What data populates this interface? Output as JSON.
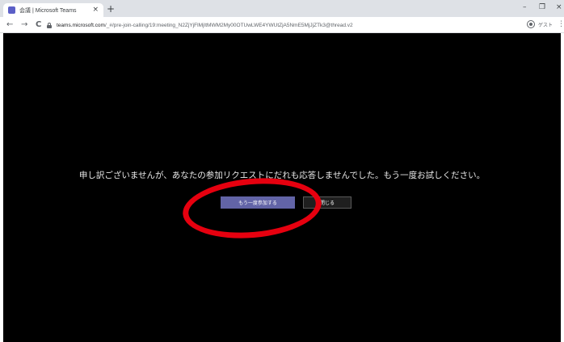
{
  "browser": {
    "tab_title": "会議 | Microsoft Teams",
    "tab_close": "×",
    "new_tab": "+",
    "url_host": "teams.microsoft.com",
    "url_path": "/_#/pre-join-calling/19:meeting_N2ZjYjFlMjItMWM2My00OTUwLWE4YWUtZjA5NmE5MjJjZTk3@thread.v2",
    "profile_label": "ゲスト",
    "window_controls": {
      "minimize": "–",
      "restore": "❐",
      "close": "×"
    },
    "nav": {
      "back": "←",
      "forward": "→",
      "reload": "C"
    },
    "menu": "⋮"
  },
  "dialog": {
    "message": "申し訳ございませんが、あなたの参加リクエストにだれも応答しませんでした。もう一度お試しください。",
    "rejoin_button": "もう一度参加する",
    "close_button": "閉じる"
  },
  "colors": {
    "background": "#000000",
    "primary_button": "#6264a7",
    "annotation": "#e6000f"
  }
}
